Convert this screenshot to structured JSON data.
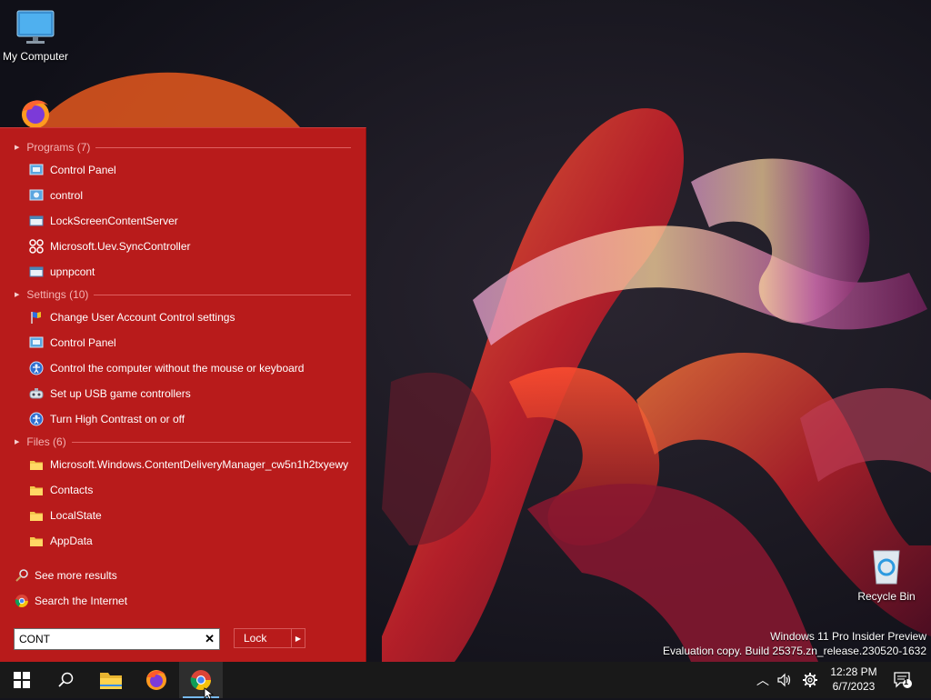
{
  "desktop": {
    "icons": [
      {
        "name": "my-computer",
        "label": "My Computer"
      },
      {
        "name": "firefox",
        "label": ""
      },
      {
        "name": "recycle-bin",
        "label": "Recycle Bin"
      }
    ],
    "watermark": {
      "line1": "Windows 11 Pro Insider Preview",
      "line2": "Evaluation copy. Build 25375.zn_release.230520-1632"
    }
  },
  "start_menu": {
    "groups": [
      {
        "header": "Programs (7)",
        "items": [
          {
            "label": "Control Panel",
            "icon": "control-panel-icon"
          },
          {
            "label": "control",
            "icon": "control-icon"
          },
          {
            "label": "LockScreenContentServer",
            "icon": "app-window-icon"
          },
          {
            "label": "Microsoft.Uev.SyncController",
            "icon": "sync-controller-icon"
          },
          {
            "label": "upnpcont",
            "icon": "app-window-icon"
          }
        ]
      },
      {
        "header": "Settings (10)",
        "items": [
          {
            "label": "Change User Account Control settings",
            "icon": "uac-flag-icon"
          },
          {
            "label": "Control Panel",
            "icon": "control-panel-icon"
          },
          {
            "label": "Control the computer without the mouse or keyboard",
            "icon": "ease-of-access-icon"
          },
          {
            "label": "Set up USB game controllers",
            "icon": "game-controller-icon"
          },
          {
            "label": "Turn High Contrast on or off",
            "icon": "ease-of-access-icon"
          }
        ]
      },
      {
        "header": "Files (6)",
        "items": [
          {
            "label": "Microsoft.Windows.ContentDeliveryManager_cw5n1h2txyewy",
            "icon": "folder-icon"
          },
          {
            "label": "Contacts",
            "icon": "folder-icon"
          },
          {
            "label": "LocalState",
            "icon": "folder-icon"
          },
          {
            "label": "AppData",
            "icon": "folder-icon"
          }
        ]
      }
    ],
    "see_more": "See more results",
    "search_internet": "Search the Internet",
    "search": {
      "value": "CONT",
      "placeholder": ""
    },
    "lock_label": "Lock"
  },
  "taskbar": {
    "apps": [
      "start-button",
      "search-button",
      "file-explorer",
      "firefox",
      "chrome"
    ],
    "active": "chrome",
    "clock": {
      "time": "12:28 PM",
      "date": "6/7/2023"
    },
    "notification_count": "1"
  },
  "colors": {
    "start_menu_bg": "#b81b1b",
    "group_header": "#f3b3b3",
    "taskbar_bg": "#191919"
  }
}
